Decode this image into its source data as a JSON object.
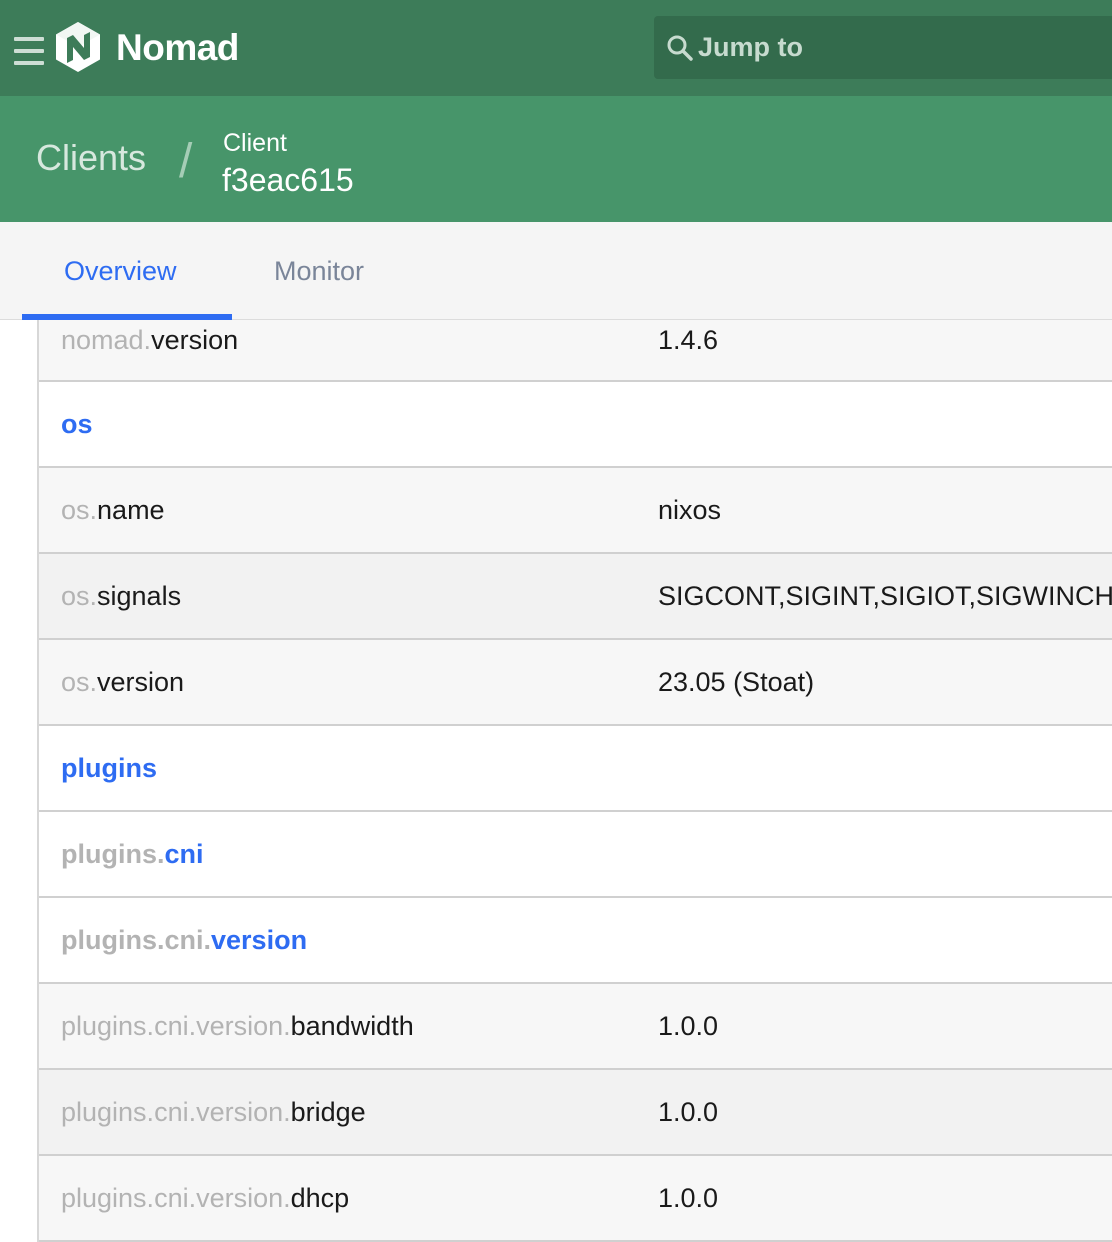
{
  "nav": {
    "brand": "Nomad",
    "search_placeholder": "Jump to"
  },
  "breadcrumb": {
    "root": "Clients",
    "separator": "/",
    "current_type": "Client",
    "current_id": "f3eac615"
  },
  "tabs": {
    "overview": "Overview",
    "monitor": "Monitor",
    "active": "Overview"
  },
  "attributes": {
    "nomad_version": {
      "prefix": "nomad.",
      "leaf": "version",
      "value": "1.4.6"
    },
    "os": {
      "label": "os"
    },
    "os_name": {
      "prefix": "os.",
      "leaf": "name",
      "value": "nixos"
    },
    "os_signals": {
      "prefix": "os.",
      "leaf": "signals",
      "value": "SIGCONT,SIGINT,SIGIOT,SIGWINCH"
    },
    "os_version": {
      "prefix": "os.",
      "leaf": "version",
      "value": "23.05 (Stoat)"
    },
    "plugins": {
      "label": "plugins"
    },
    "plugins_cni": {
      "prefix": "plugins.",
      "leaf": "cni"
    },
    "plugins_cni_version": {
      "prefix": "plugins.cni.",
      "leaf": "version"
    },
    "bandwidth": {
      "prefix": "plugins.cni.version.",
      "leaf": "bandwidth",
      "value": "1.0.0"
    },
    "bridge": {
      "prefix": "plugins.cni.version.",
      "leaf": "bridge",
      "value": "1.0.0"
    },
    "dhcp": {
      "prefix": "plugins.cni.version.",
      "leaf": "dhcp",
      "value": "1.0.0"
    }
  },
  "colors": {
    "nav_bg": "#3d7c59",
    "breadcrumb_bg": "#47956a",
    "accent": "#2e6cf2"
  }
}
